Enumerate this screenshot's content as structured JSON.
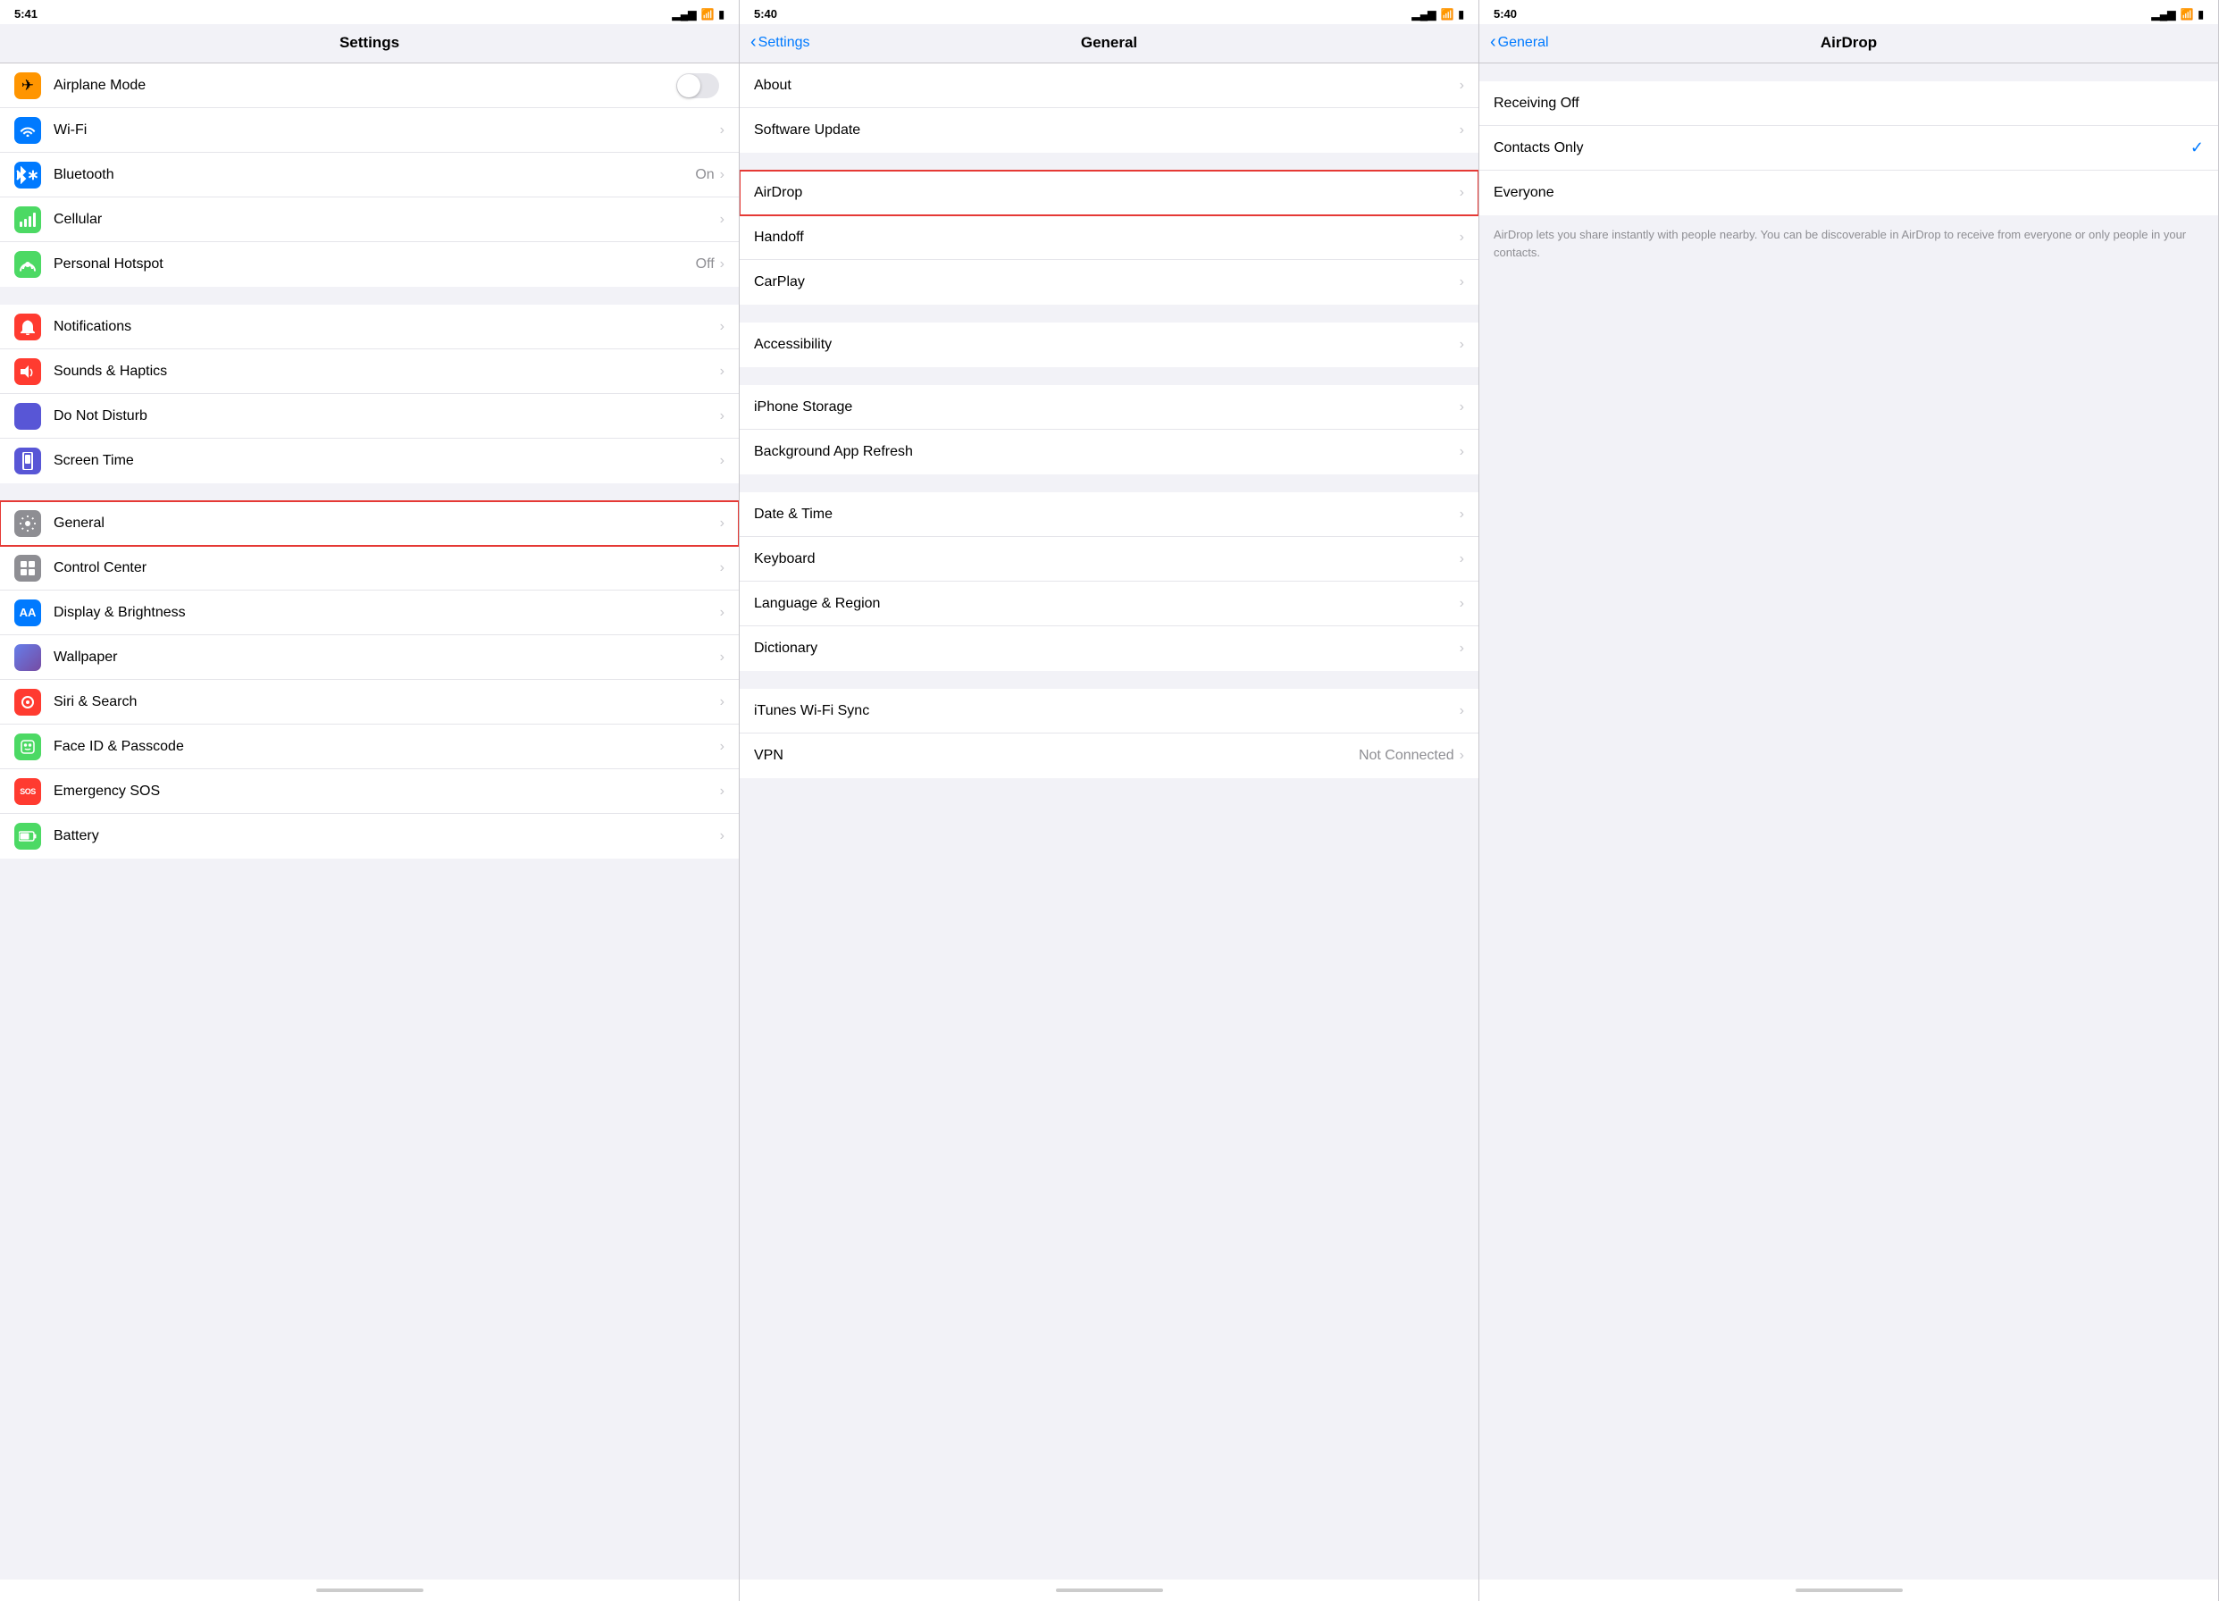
{
  "panels": [
    {
      "id": "settings",
      "statusBar": {
        "time": "5:41",
        "locationIcon": "◂",
        "signal": "▂▄▆",
        "wifi": "wifi",
        "battery": "battery"
      },
      "navTitle": "Settings",
      "backLabel": null,
      "sections": [
        {
          "rows": [
            {
              "id": "airplane",
              "icon": "✈",
              "iconBg": "#ff9500",
              "label": "Airplane Mode",
              "type": "toggle",
              "toggleOn": false
            },
            {
              "id": "wifi",
              "icon": "wifi",
              "iconBg": "#007aff",
              "label": "Wi-Fi",
              "type": "chevron"
            },
            {
              "id": "bluetooth",
              "icon": "bluetooth",
              "iconBg": "#007aff",
              "label": "Bluetooth",
              "value": "On",
              "type": "chevron"
            },
            {
              "id": "cellular",
              "icon": "cellular",
              "iconBg": "#4cd964",
              "label": "Cellular",
              "type": "chevron"
            },
            {
              "id": "hotspot",
              "icon": "hotspot",
              "iconBg": "#4cd964",
              "label": "Personal Hotspot",
              "value": "Off",
              "type": "chevron"
            }
          ]
        },
        {
          "rows": [
            {
              "id": "notifications",
              "icon": "notif",
              "iconBg": "#ff3b30",
              "label": "Notifications",
              "type": "chevron"
            },
            {
              "id": "sounds",
              "icon": "sounds",
              "iconBg": "#ff3b30",
              "label": "Sounds & Haptics",
              "type": "chevron"
            },
            {
              "id": "donotdisturb",
              "icon": "moon",
              "iconBg": "#5856d6",
              "label": "Do Not Disturb",
              "type": "chevron"
            },
            {
              "id": "screentime",
              "icon": "hourglass",
              "iconBg": "#5856d6",
              "label": "Screen Time",
              "type": "chevron"
            }
          ]
        },
        {
          "rows": [
            {
              "id": "general",
              "icon": "gear",
              "iconBg": "#8e8e93",
              "label": "General",
              "type": "chevron",
              "highlighted": true
            },
            {
              "id": "controlcenter",
              "icon": "sliders",
              "iconBg": "#8e8e93",
              "label": "Control Center",
              "type": "chevron"
            },
            {
              "id": "display",
              "icon": "AA",
              "iconBg": "#007aff",
              "label": "Display & Brightness",
              "type": "chevron"
            },
            {
              "id": "wallpaper",
              "icon": "wallpaper",
              "iconBg": "#007aff",
              "label": "Wallpaper",
              "type": "chevron"
            },
            {
              "id": "siri",
              "icon": "siri",
              "iconBg": "#ff3b30",
              "label": "Siri & Search",
              "type": "chevron"
            },
            {
              "id": "faceid",
              "icon": "faceid",
              "iconBg": "#4cd964",
              "label": "Face ID & Passcode",
              "type": "chevron"
            },
            {
              "id": "sos",
              "icon": "SOS",
              "iconBg": "#ff3b30",
              "label": "Emergency SOS",
              "type": "chevron"
            },
            {
              "id": "battery",
              "icon": "battery2",
              "iconBg": "#4cd964",
              "label": "Battery",
              "type": "chevron"
            }
          ]
        }
      ]
    },
    {
      "id": "general",
      "statusBar": {
        "time": "5:40",
        "locationIcon": "◂"
      },
      "navTitle": "General",
      "backLabel": "Settings",
      "sections": [
        {
          "rows": [
            {
              "id": "about",
              "label": "About",
              "type": "chevron"
            },
            {
              "id": "softwareupdate",
              "label": "Software Update",
              "type": "chevron"
            }
          ]
        },
        {
          "rows": [
            {
              "id": "airdrop",
              "label": "AirDrop",
              "type": "chevron",
              "highlighted": true
            },
            {
              "id": "handoff",
              "label": "Handoff",
              "type": "chevron"
            },
            {
              "id": "carplay",
              "label": "CarPlay",
              "type": "chevron"
            }
          ]
        },
        {
          "rows": [
            {
              "id": "accessibility",
              "label": "Accessibility",
              "type": "chevron"
            }
          ]
        },
        {
          "rows": [
            {
              "id": "iphonestorage",
              "label": "iPhone Storage",
              "type": "chevron"
            },
            {
              "id": "backgroundapp",
              "label": "Background App Refresh",
              "type": "chevron"
            }
          ]
        },
        {
          "rows": [
            {
              "id": "datetime",
              "label": "Date & Time",
              "type": "chevron"
            },
            {
              "id": "keyboard",
              "label": "Keyboard",
              "type": "chevron"
            },
            {
              "id": "language",
              "label": "Language & Region",
              "type": "chevron"
            },
            {
              "id": "dictionary",
              "label": "Dictionary",
              "type": "chevron"
            }
          ]
        },
        {
          "rows": [
            {
              "id": "ituneswifi",
              "label": "iTunes Wi-Fi Sync",
              "type": "chevron"
            },
            {
              "id": "vpn",
              "label": "VPN",
              "value": "Not Connected",
              "type": "chevron"
            }
          ]
        }
      ]
    },
    {
      "id": "airdrop",
      "statusBar": {
        "time": "5:40"
      },
      "navTitle": "AirDrop",
      "backLabel": "General",
      "options": [
        {
          "id": "receiving-off",
          "label": "Receiving Off",
          "selected": false
        },
        {
          "id": "contacts-only",
          "label": "Contacts Only",
          "selected": true
        },
        {
          "id": "everyone",
          "label": "Everyone",
          "selected": false
        }
      ],
      "description": "AirDrop lets you share instantly with people nearby. You can be discoverable in AirDrop to receive from everyone or only people in your contacts."
    }
  ]
}
